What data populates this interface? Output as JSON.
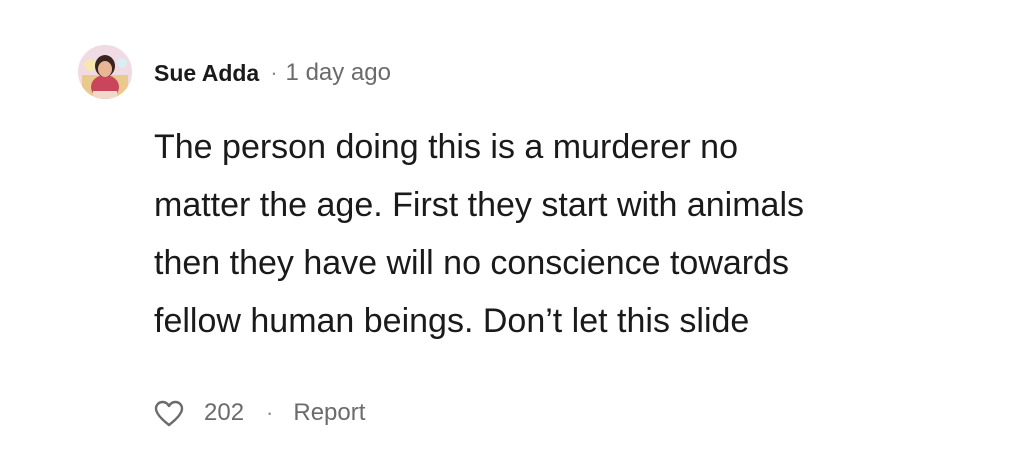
{
  "comment": {
    "author": "Sue Adda",
    "separator": "·",
    "time": "1 day ago",
    "body_lines": [
      "The person doing this is a murderer no",
      "matter the age. First they start with animals",
      "then they have will no conscience towards",
      "fellow human beings. Don’t let this slide"
    ],
    "likes": "202",
    "report_label": "Report",
    "like_icon": "heart-outline-icon",
    "avatar_icon": "user-photo-avatar"
  }
}
